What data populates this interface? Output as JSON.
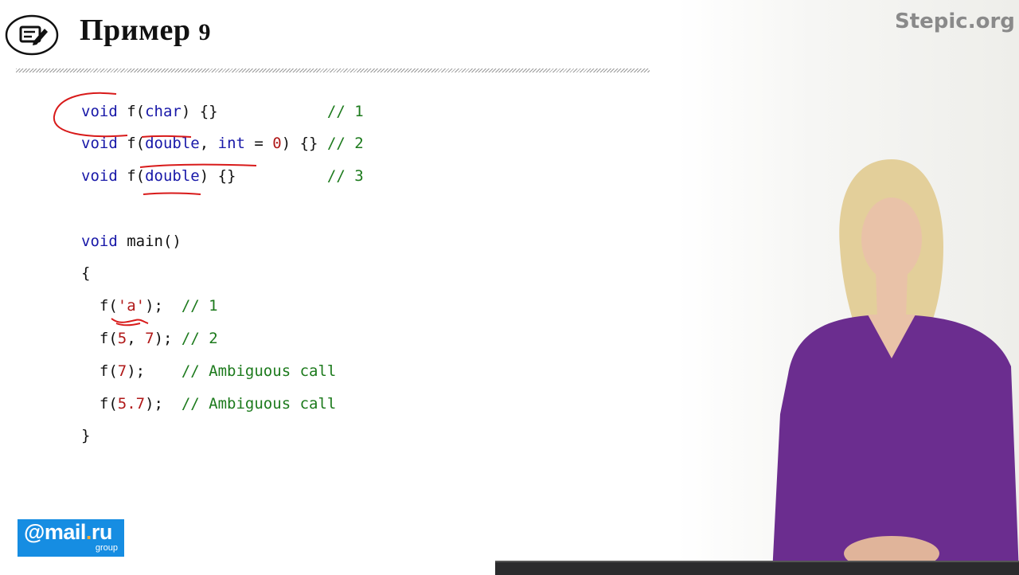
{
  "header": {
    "title": "Пример",
    "number": "9",
    "site": "Stepic.org"
  },
  "code": {
    "lines": [
      {
        "tokens": [
          {
            "t": "void",
            "c": "kw"
          },
          {
            "t": " f(",
            "c": "pl"
          },
          {
            "t": "char",
            "c": "kw"
          },
          {
            "t": ") {}            ",
            "c": "pl"
          },
          {
            "t": "// 1",
            "c": "cm"
          }
        ]
      },
      {
        "tokens": [
          {
            "t": "void",
            "c": "kw"
          },
          {
            "t": " f(",
            "c": "pl"
          },
          {
            "t": "double",
            "c": "kw"
          },
          {
            "t": ", ",
            "c": "pl"
          },
          {
            "t": "int",
            "c": "kw"
          },
          {
            "t": " = ",
            "c": "pl"
          },
          {
            "t": "0",
            "c": "lit"
          },
          {
            "t": ") {} ",
            "c": "pl"
          },
          {
            "t": "// 2",
            "c": "cm"
          }
        ]
      },
      {
        "tokens": [
          {
            "t": "void",
            "c": "kw"
          },
          {
            "t": " f(",
            "c": "pl"
          },
          {
            "t": "double",
            "c": "kw"
          },
          {
            "t": ") {}          ",
            "c": "pl"
          },
          {
            "t": "// 3",
            "c": "cm"
          }
        ]
      },
      {
        "tokens": []
      },
      {
        "tokens": [
          {
            "t": "void",
            "c": "kw"
          },
          {
            "t": " main()",
            "c": "pl"
          }
        ]
      },
      {
        "tokens": [
          {
            "t": "{",
            "c": "pl"
          }
        ]
      },
      {
        "tokens": [
          {
            "t": "  f(",
            "c": "pl"
          },
          {
            "t": "'a'",
            "c": "lit"
          },
          {
            "t": ");  ",
            "c": "pl"
          },
          {
            "t": "// 1",
            "c": "cm"
          }
        ]
      },
      {
        "tokens": [
          {
            "t": "  f(",
            "c": "pl"
          },
          {
            "t": "5",
            "c": "lit"
          },
          {
            "t": ", ",
            "c": "pl"
          },
          {
            "t": "7",
            "c": "lit"
          },
          {
            "t": "); ",
            "c": "pl"
          },
          {
            "t": "// 2",
            "c": "cm"
          }
        ]
      },
      {
        "tokens": [
          {
            "t": "  f(",
            "c": "pl"
          },
          {
            "t": "7",
            "c": "lit"
          },
          {
            "t": ");    ",
            "c": "pl"
          },
          {
            "t": "// Ambiguous call",
            "c": "cm"
          }
        ]
      },
      {
        "tokens": [
          {
            "t": "  f(",
            "c": "pl"
          },
          {
            "t": "5.7",
            "c": "lit"
          },
          {
            "t": ");  ",
            "c": "pl"
          },
          {
            "t": "// Ambiguous call",
            "c": "cm"
          }
        ]
      },
      {
        "tokens": [
          {
            "t": "}",
            "c": "pl"
          }
        ]
      }
    ]
  },
  "footer": {
    "brand_at": "@",
    "brand_mail": "mail",
    "brand_dot": ".",
    "brand_ru": "ru",
    "brand_group": "group"
  },
  "colors": {
    "keyword": "#1818a8",
    "literal": "#b01818",
    "comment": "#1c7a1c",
    "annotation": "#d81a1a",
    "mailru_blue": "#168de2",
    "mailru_dot": "#ffa930"
  },
  "icons": {
    "header": "edit-document-icon",
    "presenter": "presenter-video"
  }
}
